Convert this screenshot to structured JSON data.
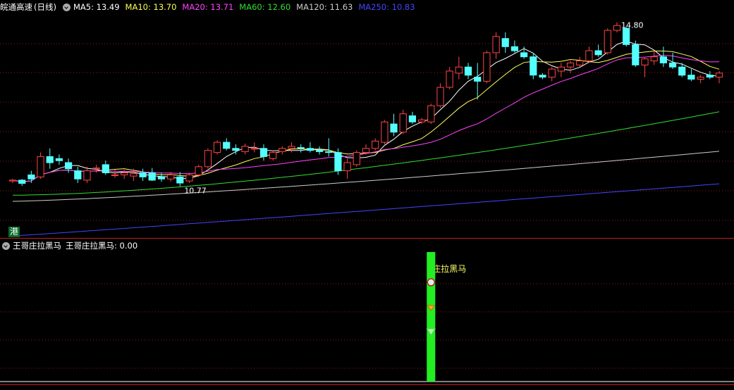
{
  "header": {
    "stock_name": "皖通高速",
    "period": "(日线)",
    "ma_labels": [
      {
        "key": "ma5",
        "text": "MA5: 13.49",
        "color": "#ffffff"
      },
      {
        "key": "ma10",
        "text": "MA10: 13.70",
        "color": "#ffff55"
      },
      {
        "key": "ma20",
        "text": "MA20: 13.71",
        "color": "#ff44ff"
      },
      {
        "key": "ma60",
        "text": "MA60: 12.60",
        "color": "#33dd33"
      },
      {
        "key": "ma120",
        "text": "MA120: 11.63",
        "color": "#cccccc"
      },
      {
        "key": "ma250",
        "text": "MA250: 10.83",
        "color": "#4444ff"
      }
    ]
  },
  "indicator": {
    "name": "王哥庄拉黑马",
    "value_label": "王哥庄拉黑马: 0.00",
    "signal_text": "庄拉黑马"
  },
  "badge": {
    "text": "港"
  },
  "colors": {
    "up": "#ff4444",
    "down": "#54ffff",
    "grid": "#8b1a1a",
    "signal_bar": "#22ee22"
  },
  "chart_data": {
    "type": "candlestick",
    "price_range": [
      9.5,
      15.0
    ],
    "high_marker": {
      "label": "14.80",
      "value": 14.8
    },
    "low_marker": {
      "label": "10.77",
      "value": 10.77
    },
    "candles": [
      [
        10.9,
        10.95,
        10.85,
        10.92
      ],
      [
        10.92,
        10.95,
        10.78,
        10.84
      ],
      [
        11.05,
        11.15,
        10.85,
        10.95
      ],
      [
        11.0,
        11.6,
        10.95,
        11.5
      ],
      [
        11.5,
        11.7,
        11.2,
        11.35
      ],
      [
        11.45,
        11.55,
        11.3,
        11.4
      ],
      [
        11.35,
        11.45,
        11.1,
        11.2
      ],
      [
        11.15,
        11.25,
        10.85,
        10.95
      ],
      [
        10.92,
        11.25,
        10.85,
        11.15
      ],
      [
        11.2,
        11.3,
        11.1,
        11.22
      ],
      [
        11.3,
        11.4,
        11.05,
        11.1
      ],
      [
        11.05,
        11.18,
        10.98,
        11.05
      ],
      [
        11.05,
        11.18,
        10.95,
        11.1
      ],
      [
        11.02,
        11.2,
        10.9,
        11.08
      ],
      [
        11.1,
        11.2,
        10.9,
        11.0
      ],
      [
        11.1,
        11.22,
        10.9,
        10.92
      ],
      [
        11.0,
        11.1,
        10.88,
        10.95
      ],
      [
        10.95,
        11.12,
        10.88,
        11.05
      ],
      [
        11.0,
        11.12,
        10.77,
        10.85
      ],
      [
        10.9,
        11.1,
        10.85,
        11.05
      ],
      [
        11.05,
        11.3,
        11.0,
        11.25
      ],
      [
        11.25,
        11.7,
        11.2,
        11.65
      ],
      [
        11.6,
        11.9,
        11.55,
        11.85
      ],
      [
        11.85,
        11.95,
        11.65,
        11.7
      ],
      [
        11.7,
        11.8,
        11.55,
        11.65
      ],
      [
        11.62,
        11.82,
        11.55,
        11.75
      ],
      [
        11.7,
        11.85,
        11.6,
        11.7
      ],
      [
        11.7,
        11.8,
        11.4,
        11.5
      ],
      [
        11.45,
        11.65,
        11.4,
        11.6
      ],
      [
        11.62,
        11.75,
        11.55,
        11.7
      ],
      [
        11.7,
        11.85,
        11.6,
        11.75
      ],
      [
        11.72,
        11.8,
        11.6,
        11.7
      ],
      [
        11.7,
        11.85,
        11.6,
        11.65
      ],
      [
        11.65,
        11.75,
        11.55,
        11.62
      ],
      [
        11.62,
        11.95,
        11.5,
        11.6
      ],
      [
        11.6,
        11.7,
        11.05,
        11.15
      ],
      [
        11.15,
        11.45,
        10.95,
        11.35
      ],
      [
        11.3,
        11.65,
        11.25,
        11.6
      ],
      [
        11.6,
        11.8,
        11.55,
        11.7
      ],
      [
        11.7,
        11.95,
        11.65,
        11.88
      ],
      [
        11.85,
        12.4,
        11.8,
        12.35
      ],
      [
        12.3,
        12.55,
        12.0,
        12.1
      ],
      [
        12.1,
        12.65,
        12.05,
        12.55
      ],
      [
        12.5,
        12.6,
        12.3,
        12.35
      ],
      [
        12.35,
        12.45,
        12.3,
        12.4
      ],
      [
        12.35,
        12.8,
        12.3,
        12.75
      ],
      [
        12.75,
        13.3,
        12.7,
        13.2
      ],
      [
        13.2,
        13.7,
        13.15,
        13.6
      ],
      [
        13.55,
        13.95,
        13.4,
        13.7
      ],
      [
        13.7,
        13.8,
        13.4,
        13.5
      ],
      [
        13.45,
        13.8,
        12.9,
        13.35
      ],
      [
        13.35,
        14.1,
        13.3,
        14.05
      ],
      [
        14.05,
        14.55,
        13.9,
        14.45
      ],
      [
        14.4,
        14.55,
        14.05,
        14.2
      ],
      [
        14.2,
        14.35,
        14.05,
        14.1
      ],
      [
        14.05,
        14.2,
        13.9,
        13.95
      ],
      [
        13.95,
        14.05,
        13.4,
        13.5
      ],
      [
        13.5,
        13.55,
        13.4,
        13.45
      ],
      [
        13.45,
        13.7,
        13.35,
        13.65
      ],
      [
        13.6,
        13.8,
        13.45,
        13.7
      ],
      [
        13.7,
        13.85,
        13.55,
        13.8
      ],
      [
        13.75,
        13.95,
        13.7,
        13.85
      ],
      [
        13.85,
        14.2,
        13.8,
        14.1
      ],
      [
        14.1,
        14.25,
        13.95,
        14.0
      ],
      [
        14.05,
        14.65,
        14.0,
        14.6
      ],
      [
        14.6,
        14.8,
        14.55,
        14.72
      ],
      [
        14.65,
        14.7,
        14.2,
        14.25
      ],
      [
        14.25,
        14.35,
        13.7,
        13.75
      ],
      [
        13.75,
        13.95,
        13.45,
        13.9
      ],
      [
        13.85,
        14.1,
        13.75,
        13.95
      ],
      [
        13.95,
        14.2,
        13.7,
        13.8
      ],
      [
        13.8,
        14.05,
        13.65,
        13.7
      ],
      [
        13.7,
        13.8,
        13.45,
        13.5
      ],
      [
        13.5,
        13.65,
        13.35,
        13.4
      ],
      [
        13.4,
        13.5,
        13.3,
        13.45
      ],
      [
        13.5,
        13.6,
        13.4,
        13.45
      ],
      [
        13.45,
        13.6,
        13.3,
        13.55
      ]
    ],
    "signal_index": 45,
    "indicator_range": [
      0,
      1
    ]
  }
}
